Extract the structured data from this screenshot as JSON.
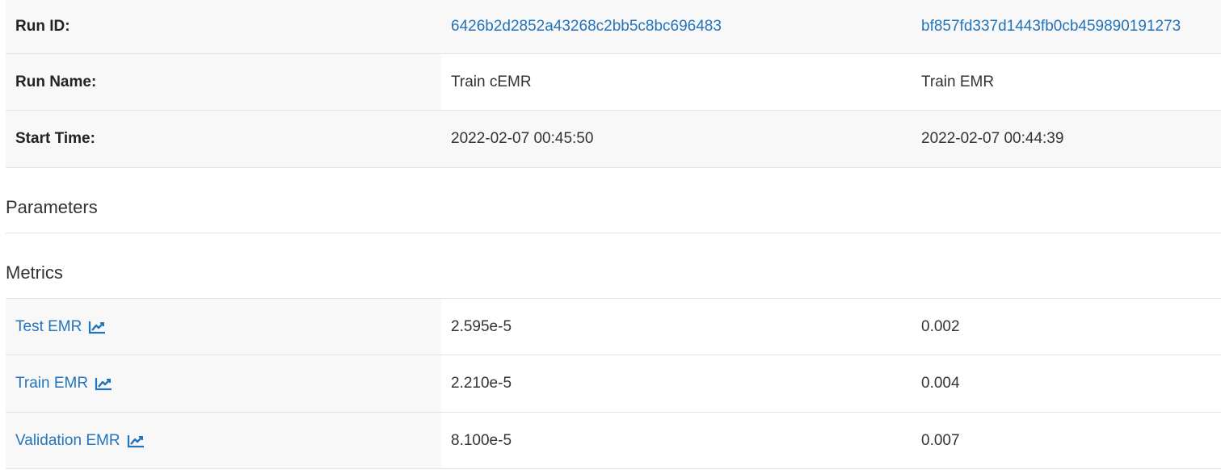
{
  "run_info": {
    "run_id": {
      "label": "Run ID:",
      "values": [
        "6426b2d2852a43268c2bb5c8bc696483",
        "bf857fd337d1443fb0cb459890191273"
      ]
    },
    "run_name": {
      "label": "Run Name:",
      "values": [
        "Train cEMR",
        "Train EMR"
      ]
    },
    "start_time": {
      "label": "Start Time:",
      "values": [
        "2022-02-07 00:45:50",
        "2022-02-07 00:44:39"
      ]
    }
  },
  "sections": {
    "parameters": "Parameters",
    "metrics": "Metrics"
  },
  "metrics": [
    {
      "name": "Test EMR",
      "icon": "line-chart-icon",
      "values": [
        "2.595e-5",
        "0.002"
      ]
    },
    {
      "name": "Train EMR",
      "icon": "line-chart-icon",
      "values": [
        "2.210e-5",
        "0.004"
      ]
    },
    {
      "name": "Validation EMR",
      "icon": "line-chart-icon",
      "values": [
        "8.100e-5",
        "0.007"
      ]
    }
  ],
  "colors": {
    "link": "#2374bb",
    "label_bg": "#f8f8f8",
    "border": "#e2e2e2"
  }
}
